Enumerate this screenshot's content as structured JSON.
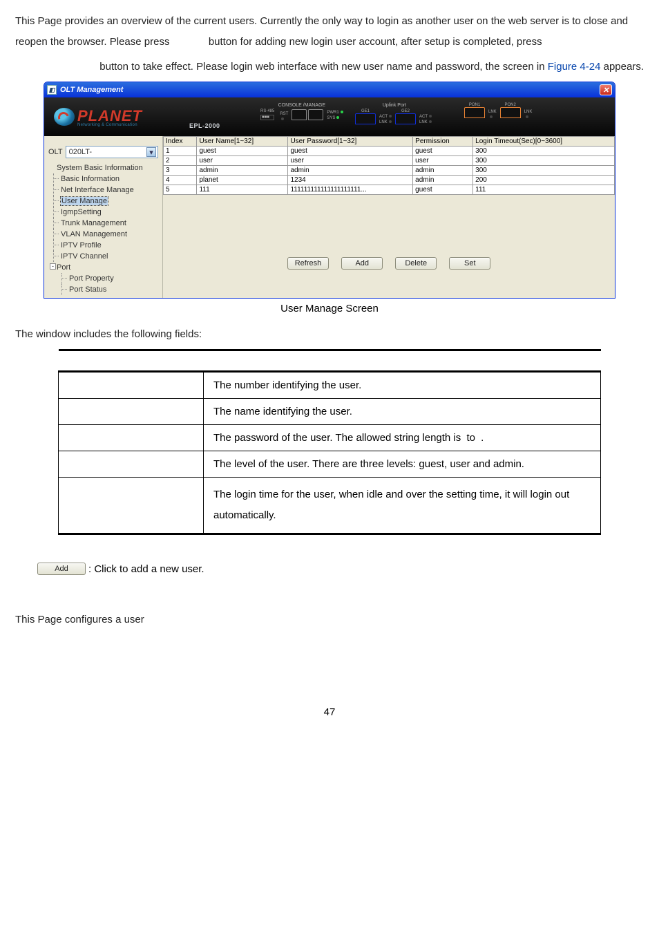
{
  "intro": {
    "p1a": "This Page provides an overview of the current users. Currently the only way to login as another user on the web server is to close and reopen the browser. Please press ",
    "p1b": " button for adding new login user account, after setup is completed, press",
    "p2a": " button to take effect. Please login web interface with new user name and password, the screen in ",
    "figref": "Figure 4-24",
    "p2b": " appears."
  },
  "window": {
    "title": "OLT Management",
    "logo_text": "PLANET",
    "logo_sub": "Networking & Communication",
    "model": "EPL-2000",
    "close_glyph": "✕",
    "banner": {
      "console_label": "CONSOLE /MANAGE",
      "rs485": "RS-485",
      "rst": "RST",
      "pwr1": "PWR1",
      "sys": "SYS",
      "uplink_label": "Uplink Port",
      "ge1": "GE1",
      "ge2": "GE2",
      "act": "ACT",
      "lnk": "LNK",
      "pon1": "PON1",
      "pon2": "PON2"
    },
    "olt_label": "OLT",
    "olt_value": "020LT-",
    "tree": {
      "root": "System Basic Information",
      "items": [
        "Basic Information",
        "Net Interface Manage",
        "User Manage",
        "IgmpSetting",
        "Trunk Management",
        "VLAN Management",
        "IPTV Profile",
        "IPTV Channel"
      ],
      "port": "Port",
      "port_children": [
        "Port Property",
        "Port Status"
      ],
      "selected_index": 2
    },
    "table": {
      "headers": [
        "Index",
        "User Name[1~32]",
        "User Password[1~32]",
        "Permission",
        "Login Timeout(Sec)[0~3600]"
      ],
      "rows": [
        [
          "1",
          "guest",
          "guest",
          "guest",
          "300"
        ],
        [
          "2",
          "user",
          "user",
          "user",
          "300"
        ],
        [
          "3",
          "admin",
          "admin",
          "admin",
          "300"
        ],
        [
          "4",
          "planet",
          "1234",
          "admin",
          "200"
        ],
        [
          "5",
          "111",
          "111111111111111111111...",
          "guest",
          "111"
        ]
      ]
    },
    "buttons": {
      "refresh": "Refresh",
      "add": "Add",
      "delete": "Delete",
      "set": "Set"
    }
  },
  "caption": " User Manage Screen",
  "fields_intro": "The window includes the following fields:",
  "fields": [
    {
      "name": "",
      "desc": "The number identifying the user."
    },
    {
      "name": "",
      "desc": "The name identifying the user."
    },
    {
      "name": "",
      "desc_a": "The password of the user. The allowed string length is ",
      "desc_b": " to ",
      "desc_c": "."
    },
    {
      "name": "",
      "desc": "The level of the user. There are three levels: guest, user and admin."
    },
    {
      "name": "",
      "desc": "The login time for the user, when idle and over the setting time, it will login out automatically."
    }
  ],
  "add_btn_label": "Add",
  "add_btn_desc": ": Click to add a new user.",
  "footer_text": "This Page configures a user",
  "page_number": "47"
}
